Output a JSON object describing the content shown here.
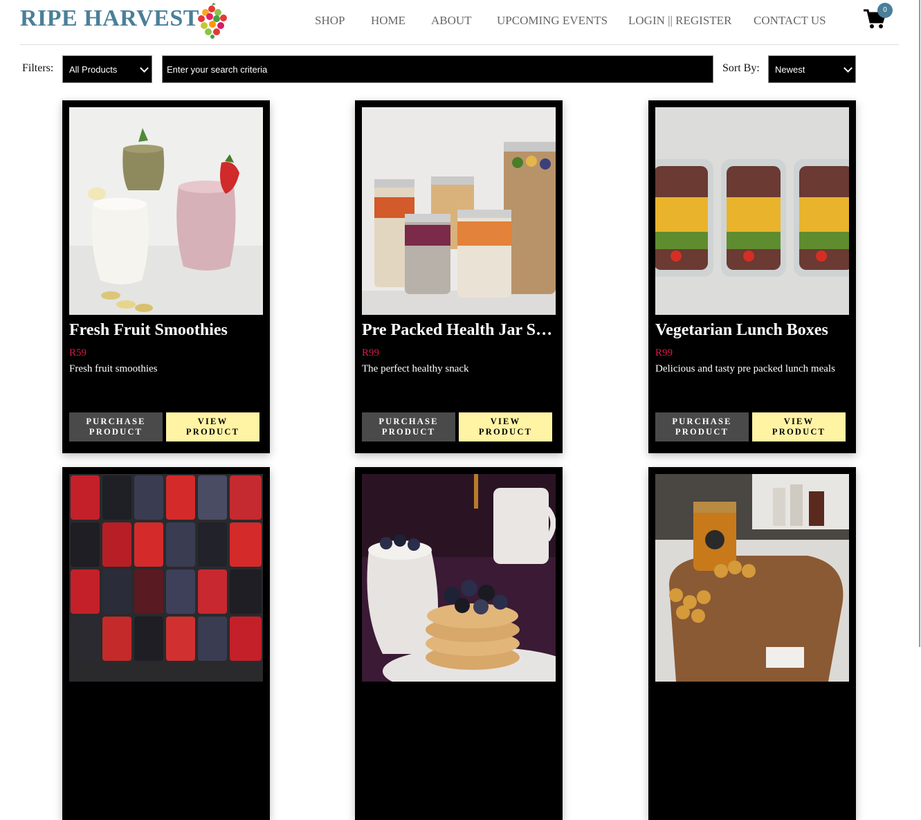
{
  "brand": {
    "name": "RIPE HARVEST"
  },
  "nav": [
    {
      "label": "SHOP"
    },
    {
      "label": "HOME"
    },
    {
      "label": "ABOUT"
    },
    {
      "label": "UPCOMING EVENTS"
    },
    {
      "label": "LOGIN || REGISTER"
    },
    {
      "label": "CONTACT US"
    }
  ],
  "cart": {
    "count": "0",
    "icon": "cart-icon"
  },
  "filters": {
    "label": "Filters:",
    "category": "All Products",
    "search_placeholder": "Enter your search criteria",
    "sort_label": "Sort By:",
    "sort_value": "Newest"
  },
  "products": [
    {
      "name": "Fresh Fruit Smoothies",
      "price": "R59",
      "description": "Fresh fruit smoothies",
      "purchase_label": "PURCHASE PRODUCT",
      "view_label": "VIEW PRODUCT"
    },
    {
      "name": "Pre Packed Health Jar Snacks",
      "price": "R99",
      "description": "The perfect healthy snack",
      "purchase_label": "PURCHASE PRODUCT",
      "view_label": "VIEW PRODUCT"
    },
    {
      "name": "Vegetarian Lunch Boxes",
      "price": "R99",
      "description": "Delicious and tasty pre packed lunch meals",
      "purchase_label": "PURCHASE PRODUCT",
      "view_label": "VIEW PRODUCT"
    },
    {
      "name": "",
      "price": "",
      "description": ""
    },
    {
      "name": "",
      "price": "",
      "description": ""
    },
    {
      "name": "",
      "price": "",
      "description": ""
    }
  ],
  "colors": {
    "brand": "#4a7f9a",
    "price": "#d81b47",
    "view_button": "#fff3a4",
    "purchase_button": "#4a4a4a"
  }
}
